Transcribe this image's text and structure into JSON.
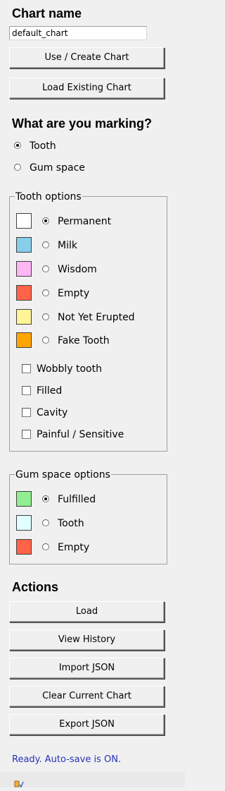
{
  "chart_name": {
    "heading": "Chart name",
    "value": "default_chart",
    "use_create_label": "Use / Create Chart",
    "load_existing_label": "Load Existing Chart"
  },
  "marking": {
    "heading": "What are you marking?",
    "options": [
      {
        "label": "Tooth",
        "selected": true
      },
      {
        "label": "Gum space",
        "selected": false
      }
    ]
  },
  "tooth_options": {
    "title": "Tooth options",
    "states": [
      {
        "label": "Permanent",
        "color": "#ffffff",
        "selected": true
      },
      {
        "label": "Milk",
        "color": "#87ceeb",
        "selected": false
      },
      {
        "label": "Wisdom",
        "color": "#ffb6f5",
        "selected": false
      },
      {
        "label": "Empty",
        "color": "#ff6347",
        "selected": false
      },
      {
        "label": "Not Yet Erupted",
        "color": "#fff497",
        "selected": false
      },
      {
        "label": "Fake Tooth",
        "color": "#ffa500",
        "selected": false
      }
    ],
    "flags": [
      {
        "label": "Wobbly tooth",
        "checked": false
      },
      {
        "label": "Filled",
        "checked": false
      },
      {
        "label": "Cavity",
        "checked": false
      },
      {
        "label": "Painful / Sensitive",
        "checked": false
      }
    ]
  },
  "gum_options": {
    "title": "Gum space options",
    "states": [
      {
        "label": "Fulfilled",
        "color": "#90ee90",
        "selected": true
      },
      {
        "label": "Tooth",
        "color": "#e0ffff",
        "selected": false
      },
      {
        "label": "Empty",
        "color": "#ff6347",
        "selected": false
      }
    ]
  },
  "actions": {
    "heading": "Actions",
    "buttons": [
      {
        "label": "Load"
      },
      {
        "label": "View History"
      },
      {
        "label": "Import JSON"
      },
      {
        "label": "Clear Current Chart"
      },
      {
        "label": "Export JSON"
      }
    ]
  },
  "status": {
    "text": "Ready. Auto-save is ON.",
    "color": "#2633b8"
  }
}
